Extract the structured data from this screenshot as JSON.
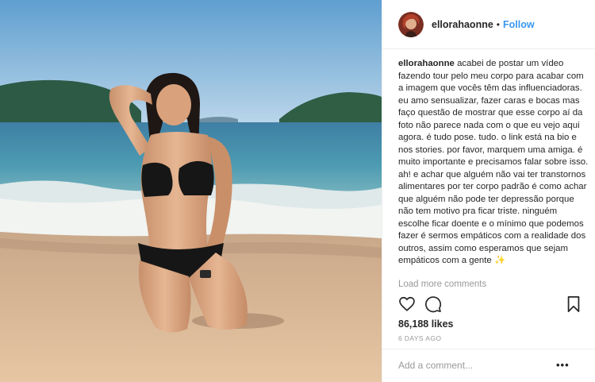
{
  "colors": {
    "accent": "#3897f0",
    "text": "#262626",
    "muted": "#999999",
    "border": "#efefef"
  },
  "header": {
    "username": "ellorahaonne",
    "separator": "•",
    "follow_label": "Follow"
  },
  "caption": {
    "username": "ellorahaonne",
    "text": "acabei de postar um vídeo fazendo tour pelo meu corpo para acabar com a imagem que vocês têm das influenciadoras. eu amo sensualizar, fazer caras e bocas mas faço questão de mostrar que esse corpo aí da foto não parece nada com o que eu vejo aqui agora. é tudo pose. tudo. o link está na bio e nos stories. por favor, marquem uma amiga. é muito importante e precisamos falar sobre isso. ah! e achar que alguém não vai ter transtornos alimentares por ter corpo padrão é como achar que alguém não pode ter depressão porque não tem motivo pra ficar triste. ninguém escolhe ficar doente e o mínimo que podemos fazer é sermos empáticos com a realidade dos outros, assim como esperamos que sejam empáticos com a gente",
    "emoji": "✨"
  },
  "load_more_label": "Load more comments",
  "icons": {
    "like": "heart-icon",
    "comment": "comment-bubble-icon",
    "save": "bookmark-icon",
    "options": "more-options-icon"
  },
  "likes_label": "86,188 likes",
  "date_label": "6 DAYS AGO",
  "comment_box": {
    "placeholder": "Add a comment...",
    "value": "",
    "options_label": "•••"
  }
}
